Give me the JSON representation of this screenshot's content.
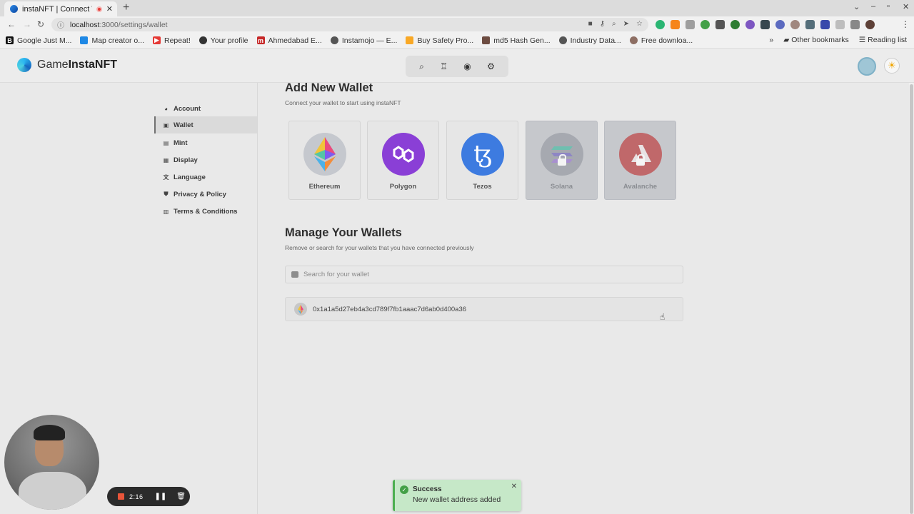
{
  "browser": {
    "tab_title": "instaNFT | Connect W...",
    "url_host": "localhost",
    "url_path": ":3000/settings/wallet",
    "bookmarks": [
      {
        "label": "Google Just M...",
        "icon": "B",
        "color": "#111111"
      },
      {
        "label": "Map creator o...",
        "icon": "map-icon",
        "color": "#1e88e5"
      },
      {
        "label": "Repeat!",
        "icon": "youtube-icon",
        "color": "#e53935"
      },
      {
        "label": "Your profile",
        "icon": "github-icon",
        "color": "#333333"
      },
      {
        "label": "Ahmedabad E...",
        "icon": "m-icon",
        "color": "#c62828"
      },
      {
        "label": "Instamojo — E...",
        "icon": "globe-icon",
        "color": "#555555"
      },
      {
        "label": "Buy Safety Pro...",
        "icon": "pen-icon",
        "color": "#f9a825"
      },
      {
        "label": "md5 Hash Gen...",
        "icon": "key-icon",
        "color": "#6d4c41"
      },
      {
        "label": "Industry Data...",
        "icon": "globe-icon",
        "color": "#555555"
      },
      {
        "label": "Free downloa...",
        "icon": "cookie-icon",
        "color": "#8d6e63"
      }
    ],
    "other_bookmarks": "Other bookmarks",
    "reading_list": "Reading list"
  },
  "app": {
    "logo_light": "Game",
    "logo_bold": "InstaNFT"
  },
  "sidebar": {
    "items": [
      {
        "label": "Account",
        "icon": "account-icon"
      },
      {
        "label": "Wallet",
        "icon": "wallet-icon",
        "active": true
      },
      {
        "label": "Mint",
        "icon": "mint-icon"
      },
      {
        "label": "Display",
        "icon": "display-icon"
      },
      {
        "label": "Language",
        "icon": "language-icon"
      },
      {
        "label": "Privacy & Policy",
        "icon": "shield-icon"
      },
      {
        "label": "Terms & Conditions",
        "icon": "document-icon"
      }
    ]
  },
  "add_wallet": {
    "title": "Add New Wallet",
    "subtitle": "Connect your wallet to start using instaNFT",
    "wallets": [
      {
        "name": "Ethereum",
        "locked": false
      },
      {
        "name": "Polygon",
        "locked": false
      },
      {
        "name": "Tezos",
        "locked": false
      },
      {
        "name": "Solana",
        "locked": true
      },
      {
        "name": "Avalanche",
        "locked": true
      }
    ]
  },
  "manage_wallets": {
    "title": "Manage Your Wallets",
    "subtitle": "Remove or search for your wallets that you have connected previously",
    "search_placeholder": "Search for your wallet",
    "wallet_address": "0x1a1a5d27eb4a3cd789f7fb1aaac7d6ab0d400a36"
  },
  "toast": {
    "title": "Success",
    "message": "New wallet address added"
  },
  "recorder": {
    "time": "2:16"
  }
}
